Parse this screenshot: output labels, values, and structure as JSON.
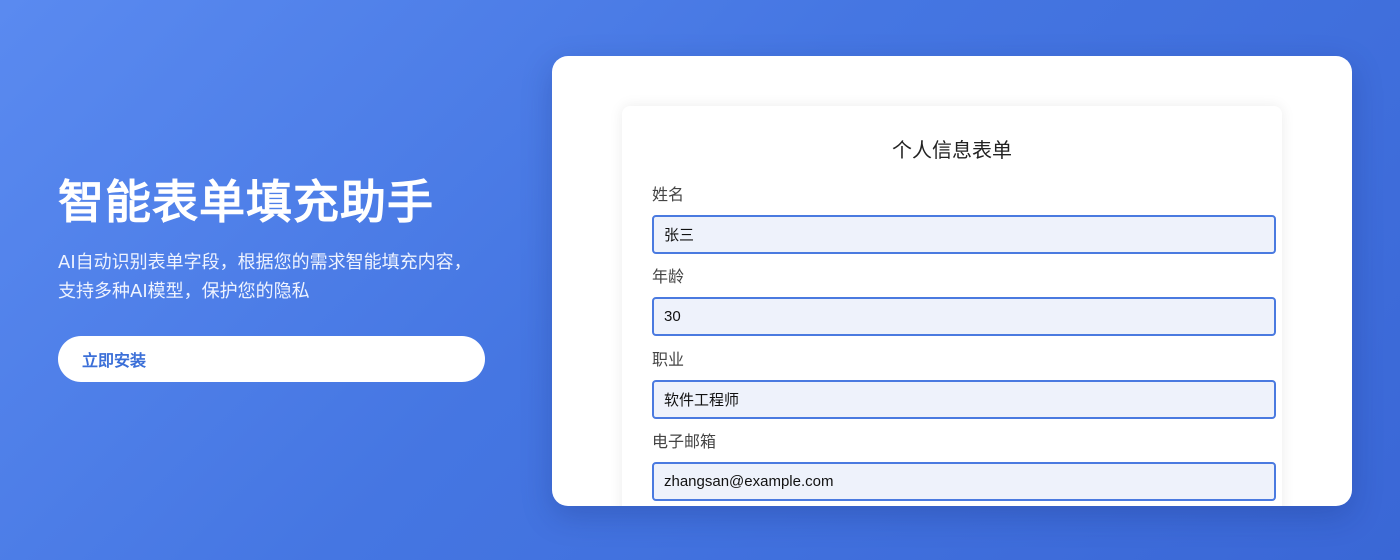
{
  "hero": {
    "title": "智能表单填充助手",
    "subtitle": "AI自动识别表单字段，根据您的需求智能填充内容，支持多种AI模型，保护您的隐私",
    "install_label": "立即安装"
  },
  "form": {
    "title": "个人信息表单",
    "fields": [
      {
        "label": "姓名",
        "value": "张三"
      },
      {
        "label": "年龄",
        "value": "30"
      },
      {
        "label": "职业",
        "value": "软件工程师"
      },
      {
        "label": "电子邮箱",
        "value": "zhangsan@example.com"
      }
    ]
  },
  "colors": {
    "background_start": "#5a8af0",
    "background_end": "#3a67d6",
    "accent": "#4a7ae0",
    "button_text": "#3b6fd8",
    "input_bg": "#eef2fb"
  }
}
